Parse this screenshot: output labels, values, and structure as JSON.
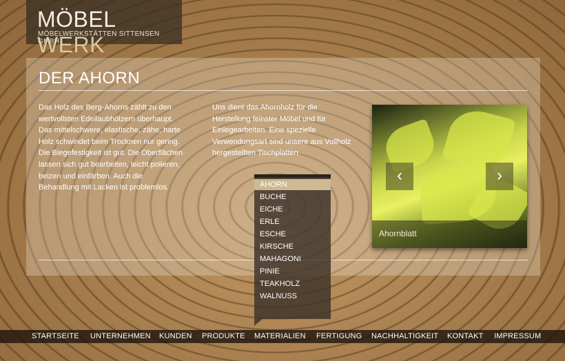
{
  "logo": {
    "title_main": "MÖBEL",
    "title_accent": "WERK",
    "subtitle": "MÖBELWERKSTÄTTEN SITTENSEN GMBH"
  },
  "page": {
    "title": "DER AHORN",
    "text_left": "Das Holz des Berg-Ahorns zählt zu den wertvollsten Edellaubhölzern überhaupt. Das mittelschwere, elastische, zähe, harte Holz schwindet beim Trocknen nur gering. Die Biegefestigkeit ist gut. Die Oberflächen lassen sich gut bearbeiten, leicht polieren, beizen und einfärben. Auch die Behandlung mit Lacken ist problemlos.",
    "text_right": "Uns dient das Ahornholz für die Herstellung feinster Möbel und für Einlegearbeiten. Eine spezielle Verwendungsart sind unsere aus Vollholz hergestellten Tischplatten."
  },
  "slider": {
    "caption": "Ahornblatt",
    "prev_icon": "chevron-left-icon",
    "next_icon": "chevron-right-icon",
    "prev_glyph": "‹",
    "next_glyph": "›"
  },
  "dropdown": {
    "items": [
      "AHORN",
      "BUCHE",
      "EICHE",
      "ERLE",
      "ESCHE",
      "KIRSCHE",
      "MAHAGONI",
      "PINIE",
      "TEAKHOLZ",
      "WALNUSS"
    ],
    "active_index": 0
  },
  "nav": {
    "items": [
      "STARTSEITE",
      "UNTERNEHMEN",
      "KUNDEN",
      "PRODUKTE",
      "MATERIALIEN",
      "FERTIGUNG",
      "NACHHALTIGKEIT",
      "KONTAKT",
      "IMPRESSUM"
    ]
  },
  "colors": {
    "accent": "#cdb992",
    "panel": "#e6dac6",
    "nav_bg": "#19120c"
  }
}
